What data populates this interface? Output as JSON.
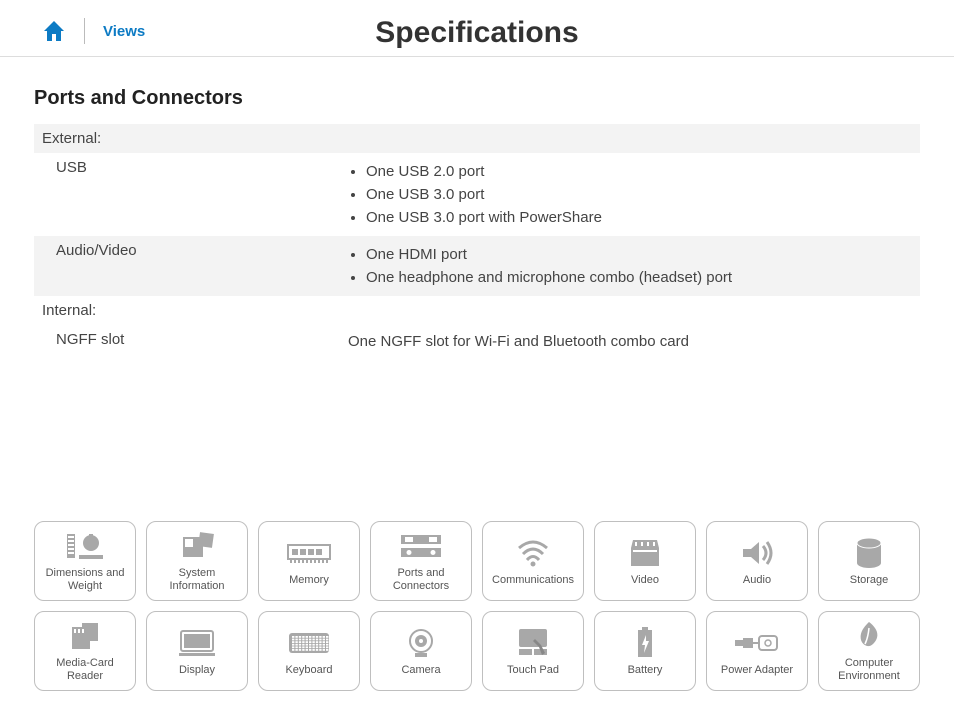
{
  "header": {
    "views_label": "Views",
    "title": "Specifications"
  },
  "section": {
    "title": "Ports and Connectors",
    "groups": [
      {
        "heading": "External:",
        "rows": [
          {
            "label": "USB",
            "items": [
              "One USB 2.0 port",
              "One USB 3.0 port",
              "One USB 3.0 port with PowerShare"
            ],
            "shaded": false
          },
          {
            "label": "Audio/Video",
            "items": [
              "One HDMI port",
              "One headphone and microphone combo (headset) port"
            ],
            "shaded": true
          }
        ]
      },
      {
        "heading": "Internal:",
        "rows": [
          {
            "label": "NGFF slot",
            "plain": "One NGFF slot for Wi-Fi and Bluetooth combo card",
            "shaded": false
          }
        ]
      }
    ]
  },
  "nav": {
    "row1": [
      {
        "id": "dimensions",
        "label": "Dimensions and Weight"
      },
      {
        "id": "sysinfo",
        "label": "System Information"
      },
      {
        "id": "memory",
        "label": "Memory"
      },
      {
        "id": "ports",
        "label": "Ports and Connectors"
      },
      {
        "id": "comm",
        "label": "Communications"
      },
      {
        "id": "video",
        "label": "Video"
      },
      {
        "id": "audio",
        "label": "Audio"
      },
      {
        "id": "storage",
        "label": "Storage"
      }
    ],
    "row2": [
      {
        "id": "mediacard",
        "label": "Media-Card Reader"
      },
      {
        "id": "display",
        "label": "Display"
      },
      {
        "id": "keyboard",
        "label": "Keyboard"
      },
      {
        "id": "camera",
        "label": "Camera"
      },
      {
        "id": "touchpad",
        "label": "Touch Pad"
      },
      {
        "id": "battery",
        "label": "Battery"
      },
      {
        "id": "poweradapter",
        "label": "Power Adapter"
      },
      {
        "id": "environment",
        "label": "Computer Environment"
      }
    ]
  }
}
